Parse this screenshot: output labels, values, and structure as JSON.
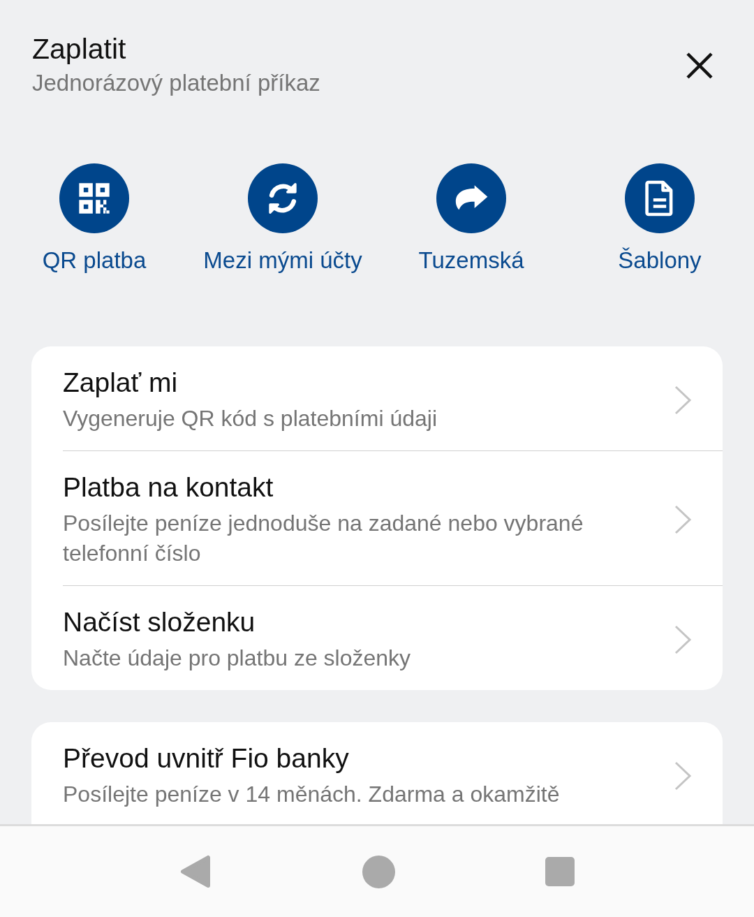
{
  "header": {
    "title": "Zaplatit",
    "subtitle": "Jednorázový platební příkaz"
  },
  "quick_actions": [
    {
      "kind": "qr",
      "label": "QR platba"
    },
    {
      "kind": "sync",
      "label": "Mezi mými účty"
    },
    {
      "kind": "forward",
      "label": "Tuzemská"
    },
    {
      "kind": "document",
      "label": "Šablony"
    }
  ],
  "sections": [
    {
      "items": [
        {
          "title": "Zaplať mi",
          "subtitle": "Vygeneruje QR kód s platebními údaji"
        },
        {
          "title": "Platba na kontakt",
          "subtitle": "Posílejte peníze jednoduše na zadané nebo vybrané telefonní číslo"
        },
        {
          "title": "Načíst složenku",
          "subtitle": "Načte údaje pro platbu ze složenky"
        }
      ]
    },
    {
      "items": [
        {
          "title": "Převod uvnitř Fio banky",
          "subtitle": "Posílejte peníze v 14 měnách. Zdarma a okamžitě"
        }
      ]
    }
  ]
}
